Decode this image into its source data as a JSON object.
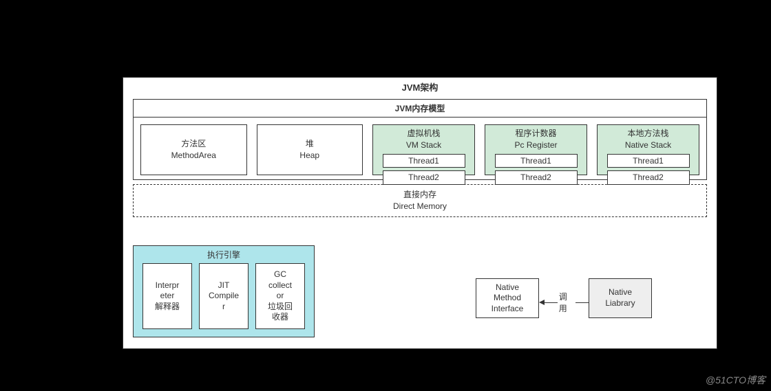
{
  "outer_title": "JVM架构",
  "mem_model_title": "JVM内存模型",
  "method_area": {
    "zh": "方法区",
    "en": "MethodArea"
  },
  "heap": {
    "zh": "堆",
    "en": "Heap"
  },
  "vm_stack": {
    "zh": "虚拟机栈",
    "en": "VM Stack",
    "t1": "Thread1",
    "t2": "Thread2"
  },
  "pc_reg": {
    "zh": "程序计数器",
    "en": "Pc Register",
    "t1": "Thread1",
    "t2": "Thread2"
  },
  "native_stack": {
    "zh": "本地方法栈",
    "en": "Native Stack",
    "t1": "Thread1",
    "t2": "Thread2"
  },
  "direct": {
    "zh": "直接内存",
    "en": "Direct Memory"
  },
  "engine_title": "执行引擎",
  "interpreter": {
    "l1": "Interpr",
    "l2": "eter",
    "l3": "解释器"
  },
  "jit": {
    "l1": "JIT",
    "l2": "Compile",
    "l3": "r"
  },
  "gc": {
    "l1": "GC",
    "l2": "collect",
    "l3": "or",
    "l4": "垃圾回",
    "l5": "收器"
  },
  "nmi": {
    "l1": "Native",
    "l2": "Method",
    "l3": "Interface"
  },
  "call_label": "调用",
  "lib": {
    "l1": "Native",
    "l2": "Liabrary"
  },
  "watermark": "@51CTO博客"
}
